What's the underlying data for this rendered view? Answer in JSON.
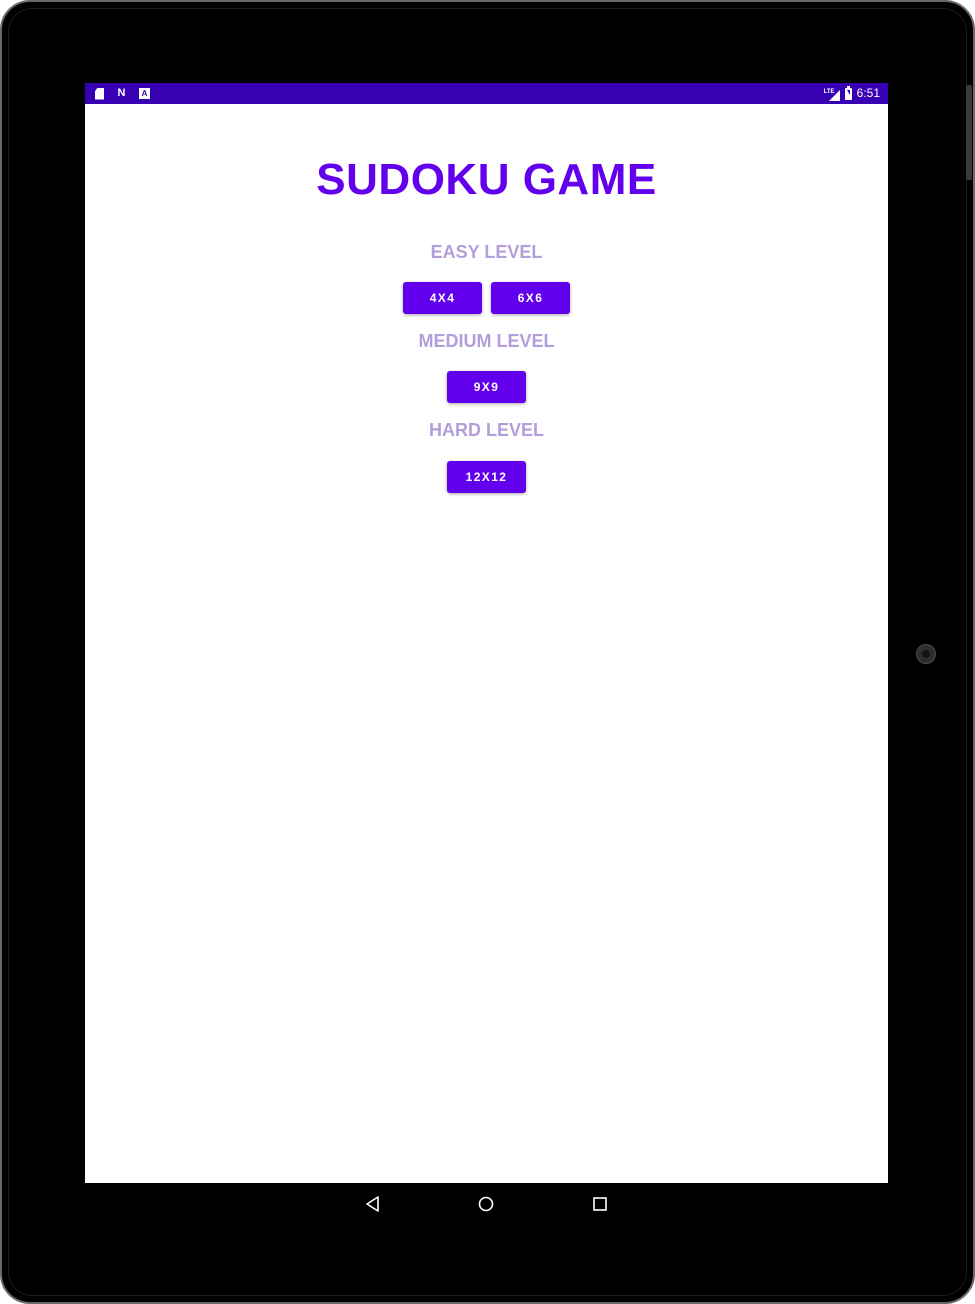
{
  "status_bar": {
    "left_icons": [
      "sd-card-icon",
      "n-notification-icon",
      "a-notification-icon"
    ],
    "n_icon_text": "N",
    "a_icon_text": "A",
    "network_text": "LTE",
    "time": "6:51"
  },
  "app": {
    "title": "SUDOKU GAME",
    "title_color": "#6200ee",
    "label_color": "#b39ddb",
    "button_color": "#6200ee",
    "status_bar_color": "#3700b3"
  },
  "levels": {
    "easy": {
      "label": "EASY LEVEL",
      "buttons": [
        "4X4",
        "6X6"
      ]
    },
    "medium": {
      "label": "MEDIUM LEVEL",
      "buttons": [
        "9X9"
      ]
    },
    "hard": {
      "label": "HARD LEVEL",
      "buttons": [
        "12X12"
      ]
    }
  },
  "nav_bar": {
    "icons": [
      "back-icon",
      "home-icon",
      "recent-apps-icon"
    ]
  }
}
